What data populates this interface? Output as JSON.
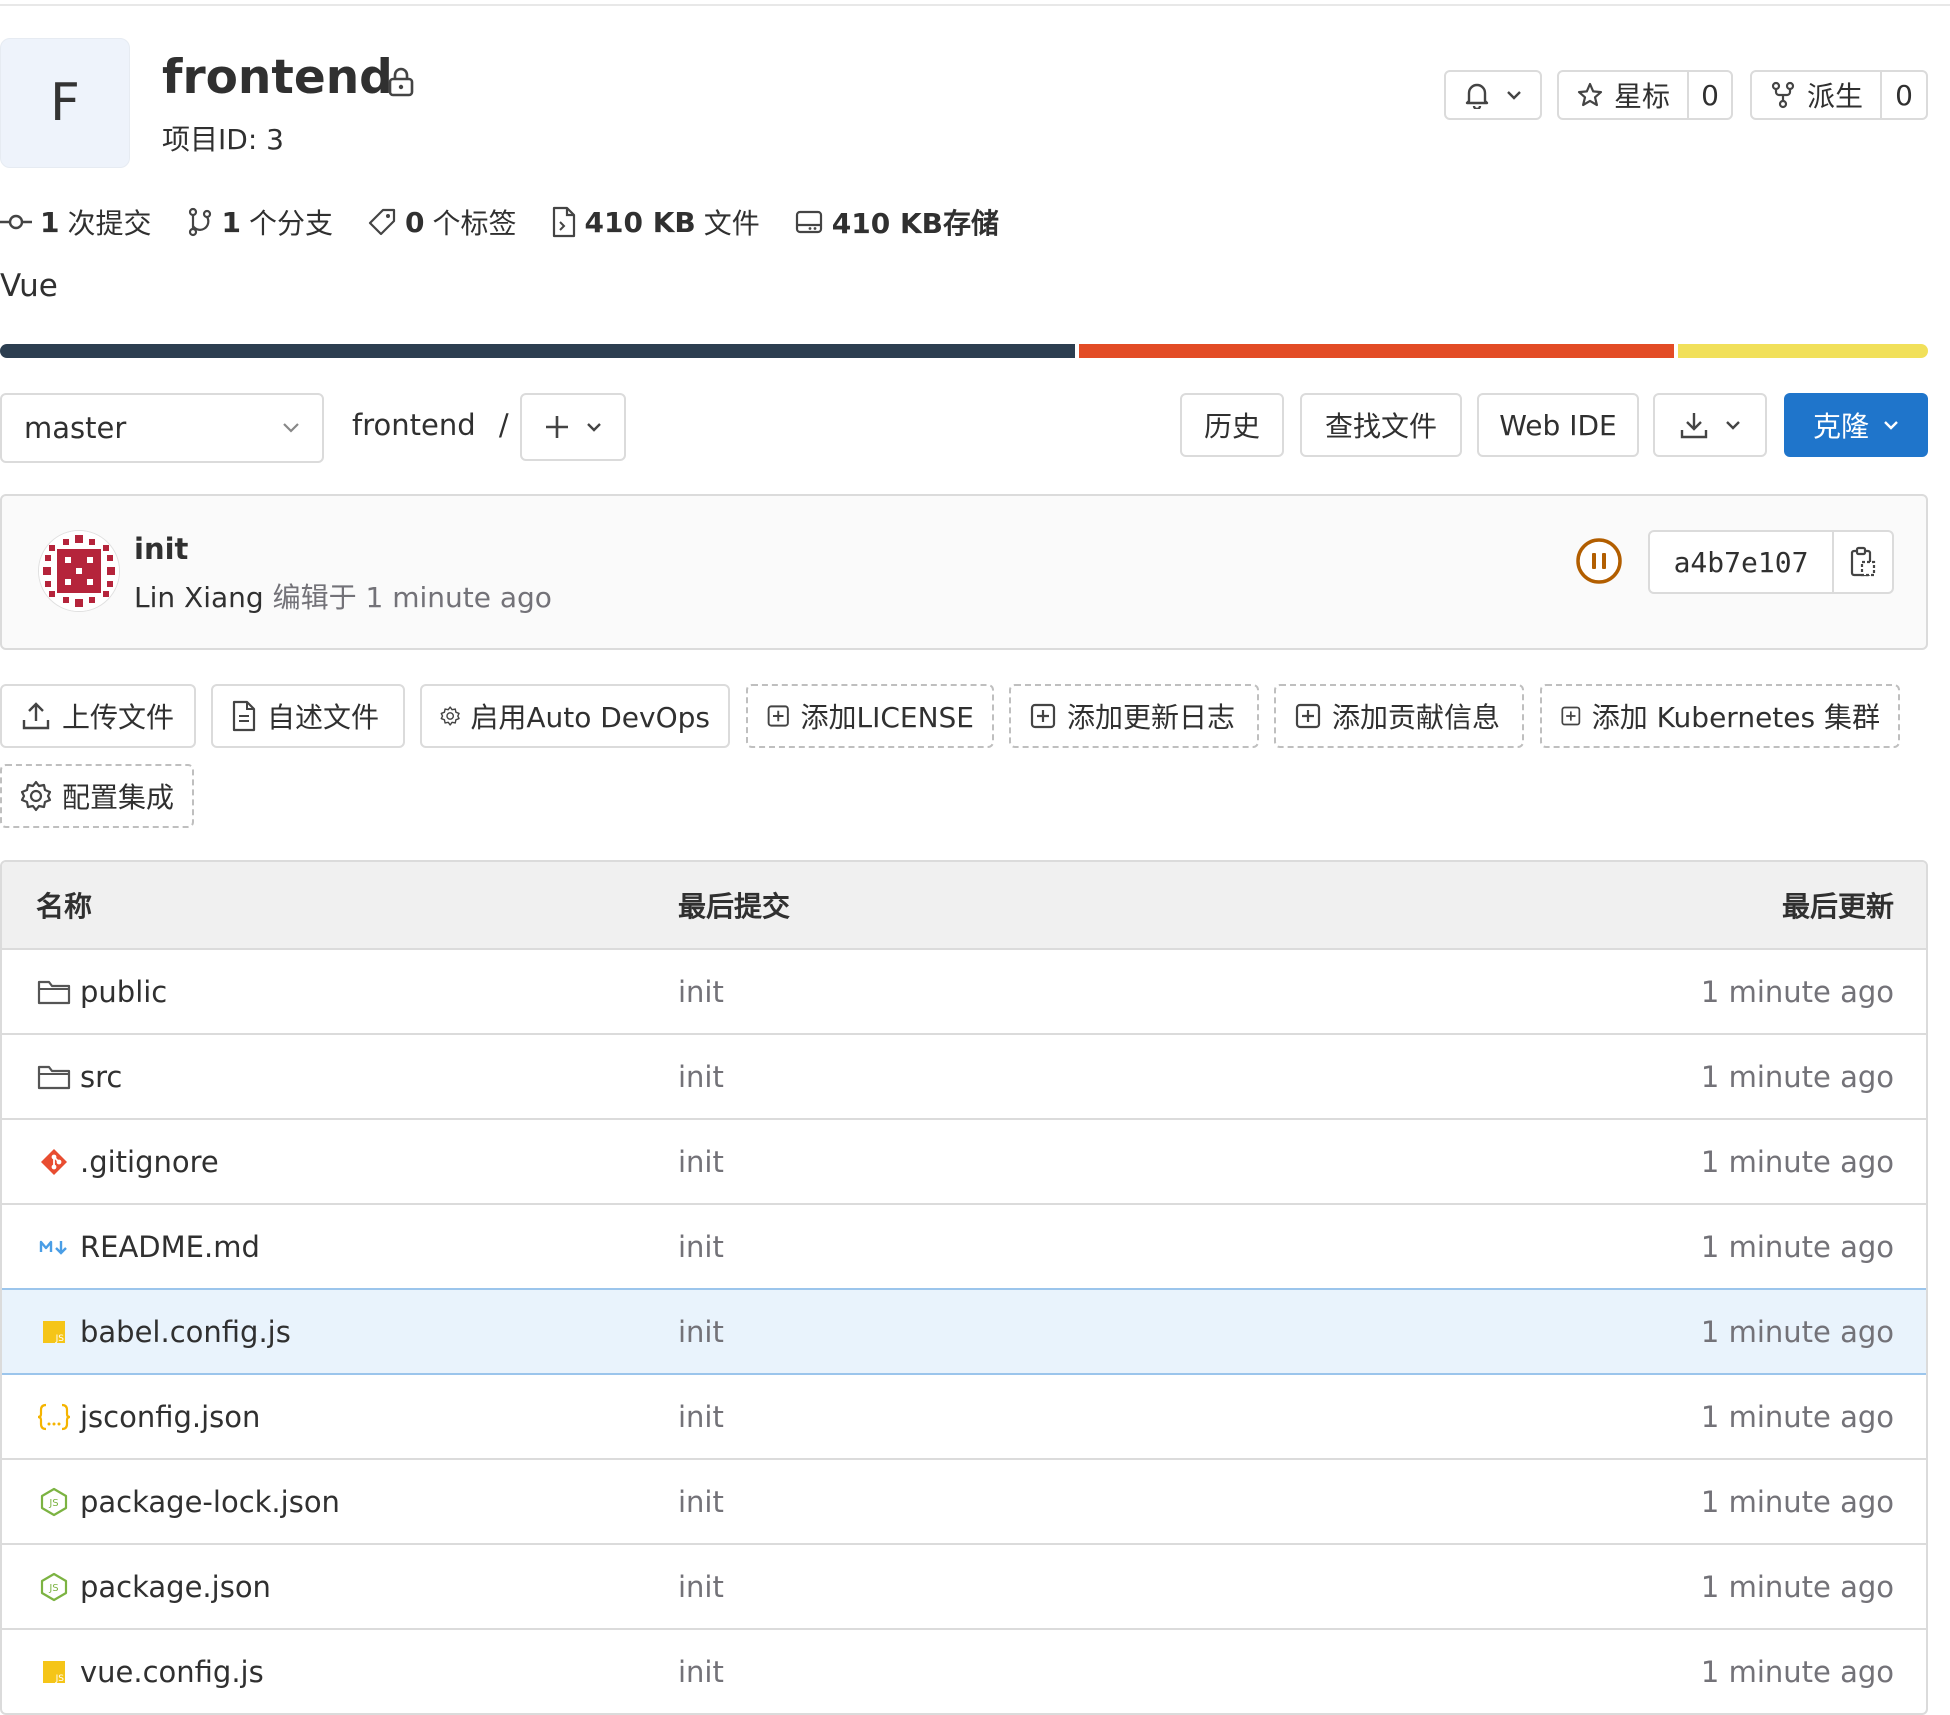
{
  "project": {
    "avatar_letter": "F",
    "name": "frontend",
    "id_label": "项目ID: 3",
    "description": "Vue"
  },
  "header_actions": {
    "star_label": "星标",
    "star_count": "0",
    "fork_label": "派生",
    "fork_count": "0"
  },
  "stats": {
    "commits_count": "1",
    "commits_label": "次提交",
    "branches_count": "1",
    "branches_label": "个分支",
    "tags_count": "0",
    "tags_label": "个标签",
    "files_size": "410 KB",
    "files_label": "文件",
    "storage": "410 KB存储"
  },
  "languages": [
    {
      "color": "#2c3e50",
      "fraction": 0.56
    },
    {
      "color": "#e34c26",
      "fraction": 0.31
    },
    {
      "color": "#f1e05a",
      "fraction": 0.13
    }
  ],
  "controls": {
    "branch": "master",
    "breadcrumb": "frontend",
    "breadcrumb_sep": "/",
    "history": "历史",
    "find_file": "查找文件",
    "web_ide": "Web IDE",
    "clone": "克隆"
  },
  "last_commit": {
    "title": "init",
    "author": "Lin Xiang",
    "edited_label": "编辑于",
    "time": "1 minute ago",
    "sha": "a4b7e107"
  },
  "actions": [
    {
      "label": "上传文件",
      "icon": "upload-icon"
    },
    {
      "label": "自述文件",
      "icon": "file-icon"
    },
    {
      "label": "启用Auto DevOps",
      "icon": "gear-icon"
    },
    {
      "label": "添加LICENSE",
      "icon": "plus-square-icon"
    },
    {
      "label": "添加更新日志",
      "icon": "plus-square-icon"
    },
    {
      "label": "添加贡献信息",
      "icon": "plus-square-icon"
    },
    {
      "label": "添加 Kubernetes 集群",
      "icon": "plus-square-icon"
    },
    {
      "label": "配置集成",
      "icon": "gear-icon"
    }
  ],
  "table": {
    "headers": {
      "name": "名称",
      "last_commit": "最后提交",
      "last_update": "最后更新"
    },
    "rows": [
      {
        "name": "public",
        "icon": "folder-icon",
        "commit": "init",
        "updated": "1 minute ago"
      },
      {
        "name": "src",
        "icon": "folder-icon",
        "commit": "init",
        "updated": "1 minute ago"
      },
      {
        "name": ".gitignore",
        "icon": "git-icon",
        "commit": "init",
        "updated": "1 minute ago"
      },
      {
        "name": "README.md",
        "icon": "markdown-icon",
        "commit": "init",
        "updated": "1 minute ago"
      },
      {
        "name": "babel.config.js",
        "icon": "js-icon",
        "commit": "init",
        "updated": "1 minute ago"
      },
      {
        "name": "jsconfig.json",
        "icon": "json-icon",
        "commit": "init",
        "updated": "1 minute ago"
      },
      {
        "name": "package-lock.json",
        "icon": "nodejs-icon",
        "commit": "init",
        "updated": "1 minute ago"
      },
      {
        "name": "package.json",
        "icon": "nodejs-icon",
        "commit": "init",
        "updated": "1 minute ago"
      },
      {
        "name": "vue.config.js",
        "icon": "js-icon",
        "commit": "init",
        "updated": "1 minute ago"
      }
    ]
  }
}
